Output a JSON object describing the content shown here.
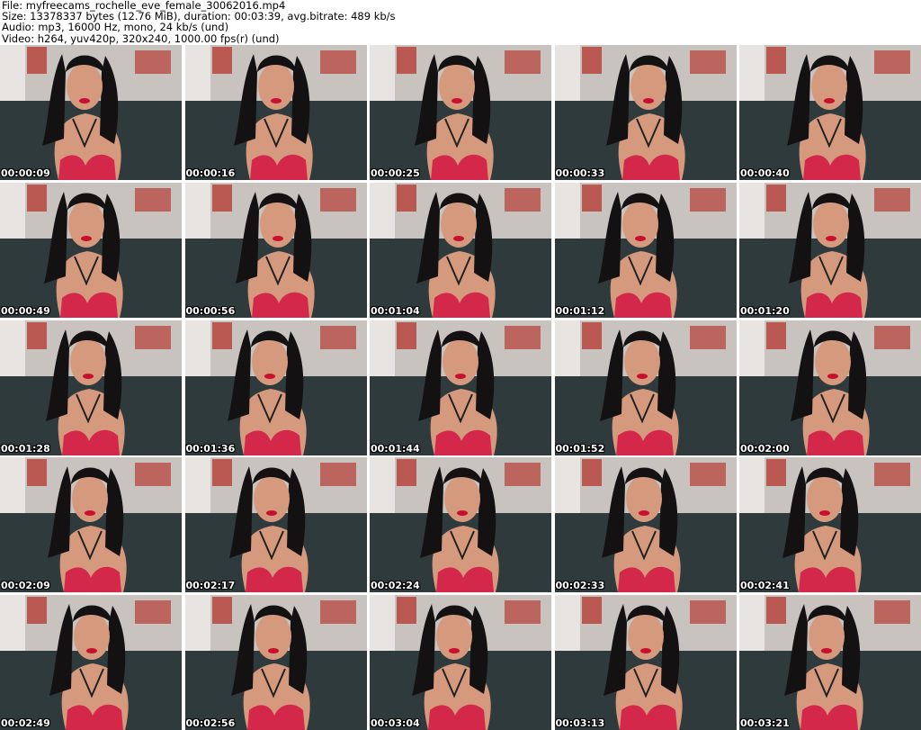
{
  "header": {
    "file": "File: myfreecams_rochelle_eve_female_30062016.mp4",
    "size": "Size: 13378337 bytes (12.76 MiB), duration: 00:03:39, avg.bitrate: 489 kb/s",
    "audio": "Audio: mp3, 16000 Hz, mono, 24 kb/s (und)",
    "video": "Video: h264, yuv420p, 320x240, 1000.00 fps(r) (und)"
  },
  "thumbnails": [
    {
      "timestamp": "00:00:09"
    },
    {
      "timestamp": "00:00:16"
    },
    {
      "timestamp": "00:00:25"
    },
    {
      "timestamp": "00:00:33"
    },
    {
      "timestamp": "00:00:40"
    },
    {
      "timestamp": "00:00:49"
    },
    {
      "timestamp": "00:00:56"
    },
    {
      "timestamp": "00:01:04"
    },
    {
      "timestamp": "00:01:12"
    },
    {
      "timestamp": "00:01:20"
    },
    {
      "timestamp": "00:01:28"
    },
    {
      "timestamp": "00:01:36"
    },
    {
      "timestamp": "00:01:44"
    },
    {
      "timestamp": "00:01:52"
    },
    {
      "timestamp": "00:02:00"
    },
    {
      "timestamp": "00:02:09"
    },
    {
      "timestamp": "00:02:17"
    },
    {
      "timestamp": "00:02:24"
    },
    {
      "timestamp": "00:02:33"
    },
    {
      "timestamp": "00:02:41"
    },
    {
      "timestamp": "00:02:49"
    },
    {
      "timestamp": "00:02:56"
    },
    {
      "timestamp": "00:03:04"
    },
    {
      "timestamp": "00:03:13"
    },
    {
      "timestamp": "00:03:21"
    }
  ],
  "colors": {
    "wall": "#c9c3c0",
    "sofa": "#2e3a3c",
    "hair": "#141112",
    "skin": "#d59a7d",
    "bra": "#d4284b",
    "lips": "#c8102e",
    "poster": "#b6463d"
  }
}
